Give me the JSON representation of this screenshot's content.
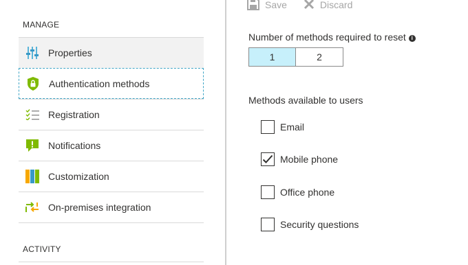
{
  "sidebar": {
    "manage_title": "MANAGE",
    "activity_title": "ACTIVITY",
    "items": [
      {
        "label": "Properties",
        "icon": "properties-icon"
      },
      {
        "label": "Authentication methods",
        "icon": "lock-shield-icon"
      },
      {
        "label": "Registration",
        "icon": "checklist-icon"
      },
      {
        "label": "Notifications",
        "icon": "notification-icon"
      },
      {
        "label": "Customization",
        "icon": "customization-icon"
      },
      {
        "label": "On-premises integration",
        "icon": "sync-icon"
      }
    ]
  },
  "toolbar": {
    "save_label": "Save",
    "discard_label": "Discard"
  },
  "reset": {
    "label": "Number of methods required to reset",
    "options": [
      "1",
      "2"
    ],
    "selected": "1"
  },
  "methods": {
    "title": "Methods available to users",
    "items": [
      {
        "label": "Email",
        "checked": false
      },
      {
        "label": "Mobile phone",
        "checked": true
      },
      {
        "label": "Office phone",
        "checked": false
      },
      {
        "label": "Security questions",
        "checked": false
      }
    ]
  },
  "colors": {
    "accent_selected": "#c7f0fb",
    "focus_border": "#3fa5c6",
    "green": "#7fba00",
    "orange": "#f7a800"
  }
}
